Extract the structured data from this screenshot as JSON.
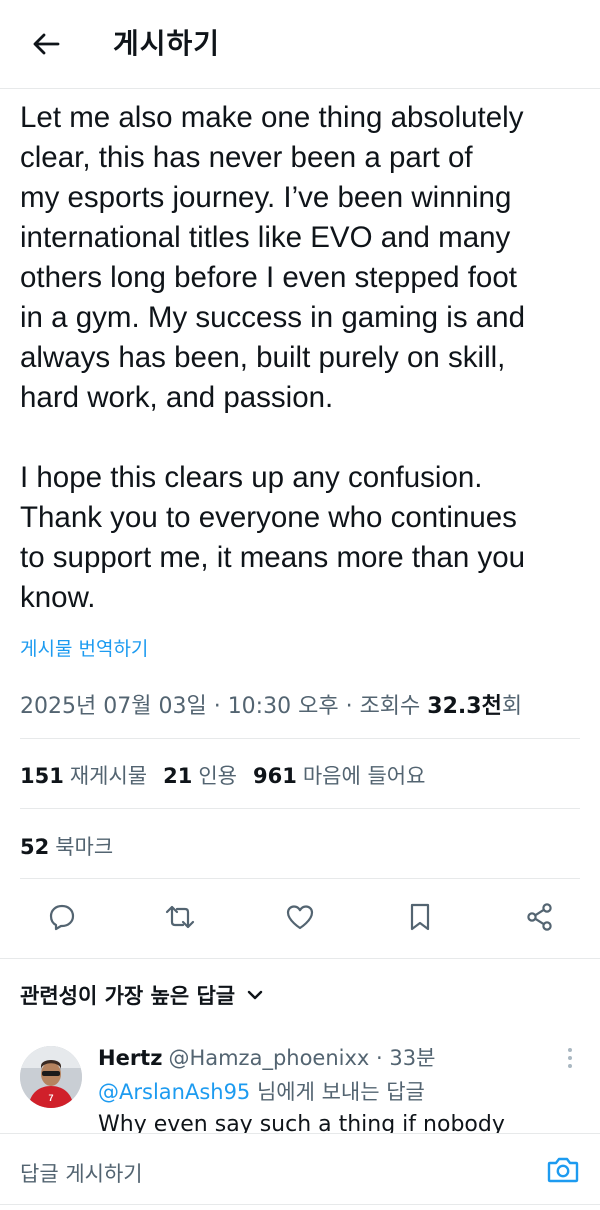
{
  "header": {
    "title": "게시하기",
    "back_icon": "arrow-left-icon"
  },
  "tweet": {
    "text": "Let me also make one thing absolutely\nclear, this has never been a part of\nmy esports journey. I’ve been winning\ninternational titles like EVO and many\nothers long before I even stepped foot\nin a gym. My success in gaming is and\nalways has been, built purely on skill,\nhard work, and passion.\n\nI hope this clears up any confusion.\nThank you to everyone who continues\nto support me, it means more than you\nknow.",
    "translate_label": "게시물 번역하기",
    "meta": {
      "date": "2025년 07월 03일",
      "time": "10:30 오후",
      "views_label": "조회수",
      "views_value": "32.3천",
      "views_suffix": "회"
    },
    "stats": [
      {
        "num": "151",
        "label": "재게시물"
      },
      {
        "num": "21",
        "label": "인용"
      },
      {
        "num": "961",
        "label": "마음에 들어요"
      }
    ],
    "bookmarks": {
      "num": "52",
      "label": "북마크"
    }
  },
  "actions": [
    "reply-icon",
    "retweet-icon",
    "like-icon",
    "bookmark-icon",
    "share-icon"
  ],
  "replies": {
    "filter_label": "관련성이 가장 높은 답글",
    "items": [
      {
        "name": "Hertz",
        "handle": "@Hamza_phoenixx",
        "age": "33분",
        "reply_to_mention": "@ArslanAsh95",
        "reply_to_suffix": " 님에게 보내는 답글",
        "text": "Why even say such a thing if nobody"
      }
    ]
  },
  "composer": {
    "placeholder": "답글 게시하기",
    "camera_icon": "camera-icon"
  },
  "colors": {
    "accent": "#1d9bf0",
    "text": "#0f1419",
    "muted": "#536471",
    "divider": "#e7e9ea"
  }
}
